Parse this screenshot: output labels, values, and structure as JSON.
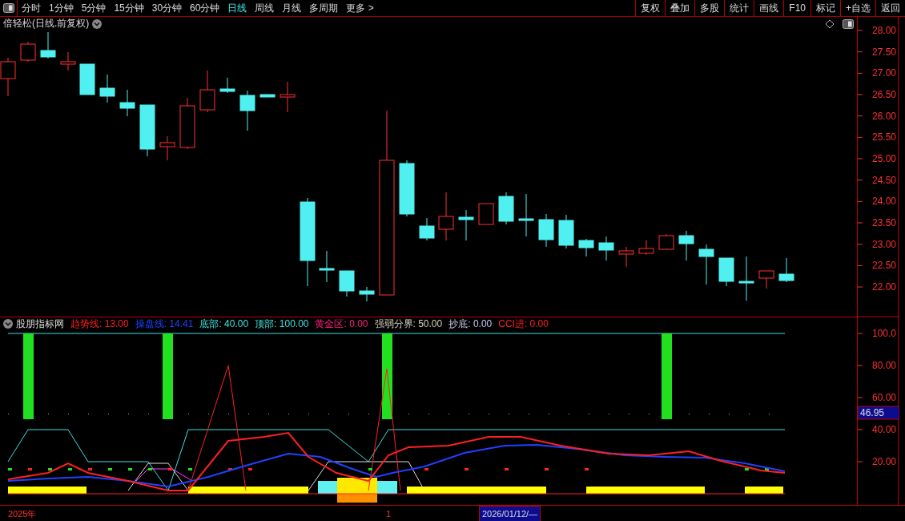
{
  "toolbar": {
    "periods": [
      {
        "label": "分时",
        "selected": false
      },
      {
        "label": "1分钟",
        "selected": false
      },
      {
        "label": "5分钟",
        "selected": false
      },
      {
        "label": "15分钟",
        "selected": false
      },
      {
        "label": "30分钟",
        "selected": false
      },
      {
        "label": "60分钟",
        "selected": false
      },
      {
        "label": "日线",
        "selected": true
      },
      {
        "label": "周线",
        "selected": false
      },
      {
        "label": "月线",
        "selected": false
      },
      {
        "label": "多周期",
        "selected": false
      },
      {
        "label": "更多 >",
        "selected": false
      }
    ],
    "buttons": [
      "复权",
      "叠加",
      "多股",
      "统计",
      "画线",
      "F10",
      "标记",
      "+自选",
      "返回"
    ]
  },
  "price_chart": {
    "title": "倍轻松(日线.前复权)",
    "axis_labels": [
      "28.00",
      "27.50",
      "27.00",
      "26.50",
      "26.00",
      "25.50",
      "25.00",
      "24.50",
      "24.00",
      "23.50",
      "23.00",
      "22.50",
      "22.00"
    ]
  },
  "indicator": {
    "name": "股朋指标网",
    "values": [
      {
        "label": "趋势线:",
        "value": "13.00",
        "color": "#ff2020"
      },
      {
        "label": "操盘线:",
        "value": "14.41",
        "color": "#2040ff"
      },
      {
        "label": "底部:",
        "value": "40.00",
        "color": "#40e0e0"
      },
      {
        "label": "顶部:",
        "value": "100.00",
        "color": "#40e0e0"
      },
      {
        "label": "黄金区:",
        "value": "0.00",
        "color": "#ff2080"
      },
      {
        "label": "强弱分界:",
        "value": "50.00",
        "color": "#d8d0c0"
      },
      {
        "label": "抄底:",
        "value": "0.00",
        "color": "#c8c8f0"
      },
      {
        "label": "CCI进:",
        "value": "0.00",
        "color": "#ff2020"
      }
    ],
    "axis_labels": [
      "100.0",
      "80.00",
      "60.00",
      "40.00",
      "20.00"
    ],
    "cursor_value": "46.95"
  },
  "timeline": {
    "year": "2025年",
    "month_mark": "1",
    "cursor_date": "2026/01/12/—"
  }
}
